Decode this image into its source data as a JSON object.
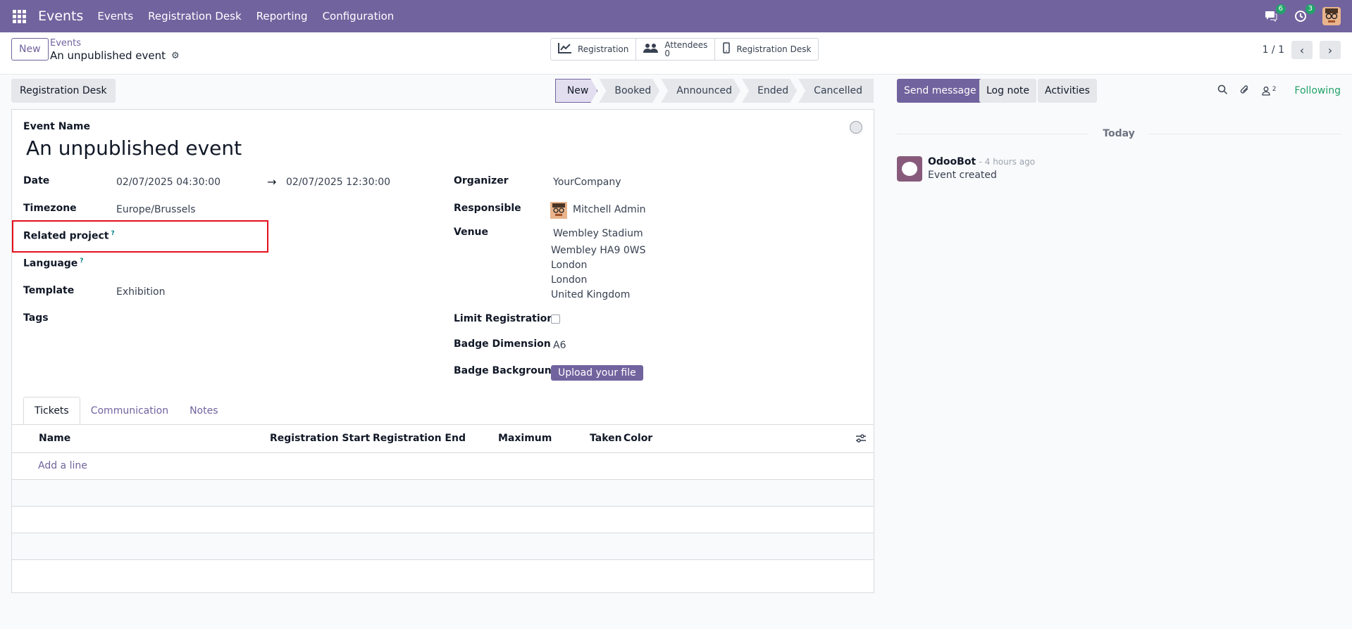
{
  "navbar": {
    "brand": "Events",
    "menu": [
      "Events",
      "Registration Desk",
      "Reporting",
      "Configuration"
    ],
    "messages_count": "6",
    "activities_count": "3"
  },
  "control_panel": {
    "new_label": "New",
    "breadcrumb_parent": "Events",
    "breadcrumb_current": "An unpublished event",
    "smart_buttons": {
      "registration": "Registration",
      "attendees_label": "Attendees",
      "attendees_count": "0",
      "registration_desk": "Registration Desk"
    },
    "pager": "1 / 1"
  },
  "statusbar": {
    "registration_desk_button": "Registration Desk",
    "stages": [
      "New",
      "Booked",
      "Announced",
      "Ended",
      "Cancelled"
    ],
    "active_stage": "New"
  },
  "form": {
    "event_name_label": "Event Name",
    "event_name": "An unpublished event",
    "date_label": "Date",
    "date_start": "02/07/2025 04:30:00",
    "date_arrow": "→",
    "date_end": "02/07/2025 12:30:00",
    "timezone_label": "Timezone",
    "timezone": "Europe/Brussels",
    "related_project_label": "Related project",
    "help_mark": "?",
    "language_label": "Language",
    "template_label": "Template",
    "template": "Exhibition",
    "tags_label": "Tags",
    "organizer_label": "Organizer",
    "organizer": "YourCompany",
    "responsible_label": "Responsible",
    "responsible": "Mitchell Admin",
    "venue_label": "Venue",
    "venue_lines": [
      "Wembley Stadium",
      "Wembley HA9 0WS",
      "London",
      "London",
      "United Kingdom"
    ],
    "limit_registrations_label": "Limit Registrations",
    "limit_registrations_checked": false,
    "badge_dimension_label": "Badge Dimension",
    "badge_dimension": "A6",
    "badge_background_label": "Badge Background",
    "upload_label": "Upload your file"
  },
  "tabs": [
    "Tickets",
    "Communication",
    "Notes"
  ],
  "tickets_table": {
    "columns": [
      "Name",
      "Registration Start",
      "Registration End",
      "Maximum",
      "Taken",
      "Color"
    ],
    "add_line": "Add a line"
  },
  "chatter": {
    "send_message": "Send message",
    "log_note": "Log note",
    "activities": "Activities",
    "followers_count": "2",
    "following": "Following",
    "date_separator": "Today",
    "message": {
      "author": "OdooBot",
      "time": "- 4 hours ago",
      "body": "Event created"
    }
  }
}
